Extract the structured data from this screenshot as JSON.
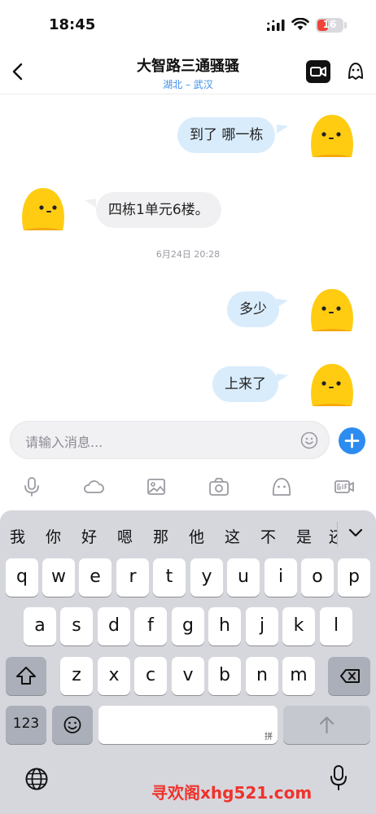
{
  "status_bar": {
    "time": "18:45",
    "battery": "16"
  },
  "nav": {
    "title": "大智路三通骚骚",
    "location": "湖北 – 武汉"
  },
  "messages": [
    {
      "from": "me",
      "text": "到了 哪一栋"
    },
    {
      "from": "other",
      "text": "四栋1单元6楼。"
    },
    {
      "type": "timestamp",
      "text": "6月24日 20:28"
    },
    {
      "from": "me",
      "text": "多少"
    },
    {
      "from": "me",
      "text": "上来了"
    }
  ],
  "input": {
    "placeholder": "请输入消息..."
  },
  "toolbar": [
    "mic-icon",
    "cloud-icon",
    "image-icon",
    "camera-icon",
    "sticker-icon",
    "gif-icon"
  ],
  "keyboard": {
    "candidates": [
      "我",
      "你",
      "好",
      "嗯",
      "那",
      "他",
      "这",
      "不",
      "是",
      "还"
    ],
    "row1": [
      "q",
      "w",
      "e",
      "r",
      "t",
      "y",
      "u",
      "i",
      "o",
      "p"
    ],
    "row2": [
      "a",
      "s",
      "d",
      "f",
      "g",
      "h",
      "j",
      "k",
      "l"
    ],
    "row3": [
      "z",
      "x",
      "c",
      "v",
      "b",
      "n",
      "m"
    ],
    "num_key": "123",
    "space_hint": "拼"
  },
  "watermark": "寻欢阁xhg521.com",
  "colors": {
    "accent_blue": "#2d8cf0",
    "my_bubble": "#d9ecfc",
    "other_bubble": "#f0f0f2",
    "avatar_yellow": "#ffcc12",
    "watermark_red": "#f0322c"
  }
}
